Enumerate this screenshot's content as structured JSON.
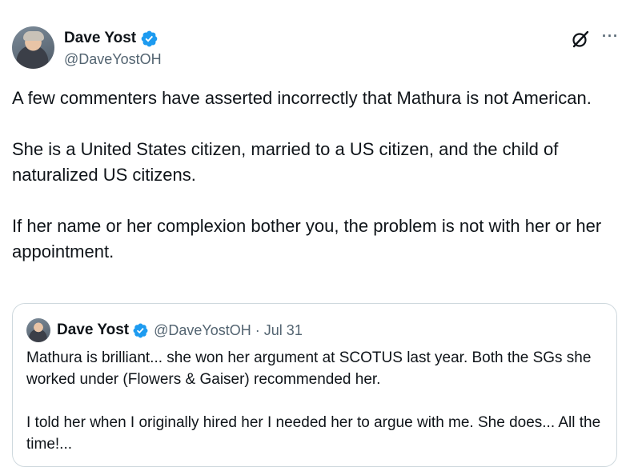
{
  "author": {
    "name": "Dave Yost",
    "handle": "@DaveYostOH",
    "verified_icon": "verified-badge-icon",
    "verified_color": "#1d9bf0"
  },
  "actions": {
    "grok_icon": "grok-icon",
    "more_icon": "more-options-icon",
    "more_label": "···"
  },
  "tweet": {
    "paragraphs": [
      "A few commenters have asserted incorrectly that Mathura is not American.",
      "She is a United States citizen, married to a US citizen, and the child of naturalized US citizens.",
      "If her name or her complexion bother you, the problem is not with her or her appointment."
    ]
  },
  "quote": {
    "name": "Dave Yost",
    "handle": "@DaveYostOH",
    "separator": "·",
    "date": "Jul 31",
    "paragraphs": [
      "Mathura is brilliant... she won her argument at SCOTUS last year.  Both the SGs she worked under (Flowers & Gaiser) recommended her.",
      "I told her when I originally hired her I needed her to argue with me. She does... All the time!..."
    ]
  },
  "colors": {
    "text": "#0f1419",
    "secondary": "#536471",
    "border": "#cfd9de",
    "accent": "#1d9bf0"
  }
}
